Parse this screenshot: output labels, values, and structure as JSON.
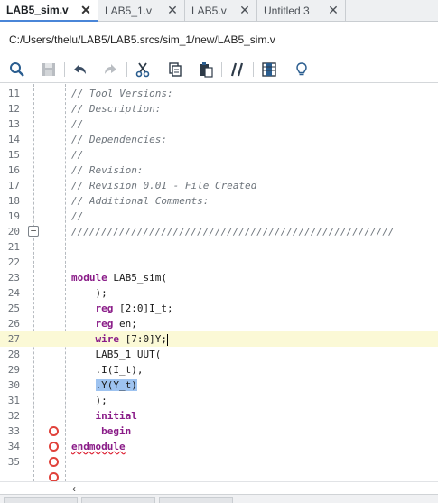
{
  "tabs": [
    {
      "label": "LAB5_sim.v",
      "active": true
    },
    {
      "label": "LAB5_1.v",
      "active": false
    },
    {
      "label": "LAB5.v",
      "active": false
    },
    {
      "label": "Untitled 3",
      "active": false
    }
  ],
  "close_glyph": "✕",
  "file_path": "C:/Users/thelu/LAB5/LAB5.srcs/sim_1/new/LAB5_sim.v",
  "toolbar": {
    "items": [
      "search-icon",
      "save-icon",
      "undo-icon",
      "redo-icon",
      "cut-icon",
      "copy-icon",
      "paste-icon",
      "comment-toggle-icon",
      "column-select-icon",
      "lightbulb-icon"
    ]
  },
  "editor": {
    "lines": [
      {
        "n": "11",
        "text": "// Tool Versions:"
      },
      {
        "n": "12",
        "text": "// Description:"
      },
      {
        "n": "13",
        "text": "//"
      },
      {
        "n": "14",
        "text": "// Dependencies:"
      },
      {
        "n": "15",
        "text": "//"
      },
      {
        "n": "16",
        "text": "// Revision:"
      },
      {
        "n": "17",
        "text": "// Revision 0.01 - File Created"
      },
      {
        "n": "18",
        "text": "// Additional Comments:"
      },
      {
        "n": "19",
        "text": "//"
      },
      {
        "n": "20",
        "text": "//////////////////////////////////////////////////////"
      },
      {
        "n": "21",
        "text": ""
      },
      {
        "n": "22",
        "text": ""
      },
      {
        "n": "23",
        "text": "module LAB5_sim("
      },
      {
        "n": "24",
        "text": "    );"
      },
      {
        "n": "25",
        "text": "    reg [2:0]I_t;"
      },
      {
        "n": "26",
        "text": "    reg en;"
      },
      {
        "n": "27",
        "text": "    wire [7:0]Y;"
      },
      {
        "n": "28",
        "text": "    LAB5_1 UUT("
      },
      {
        "n": "29",
        "text": "    .I(I_t),"
      },
      {
        "n": "30",
        "text": "    .Y(Y_t)"
      },
      {
        "n": "31",
        "text": "    );"
      },
      {
        "n": "32",
        "text": "    initial"
      },
      {
        "n": "33",
        "text": "     begin"
      },
      {
        "n": "34",
        "text": "endmodule"
      },
      {
        "n": "35",
        "text": ""
      },
      {
        "n": "",
        "text": ""
      }
    ],
    "current_line": "27",
    "selected_line": "30",
    "breakpoint_lines": [
      "33",
      "34",
      "35",
      ""
    ],
    "fold_line": "20"
  },
  "hscroll_left_glyph": "‹",
  "colors": {
    "keyword": "#8a1c88",
    "comment": "#6f767d",
    "selection": "#9ec3f0",
    "current_line": "#fbf9d6",
    "breakpoint": "#e0413a",
    "active_tab_underline": "#4a86d8"
  }
}
